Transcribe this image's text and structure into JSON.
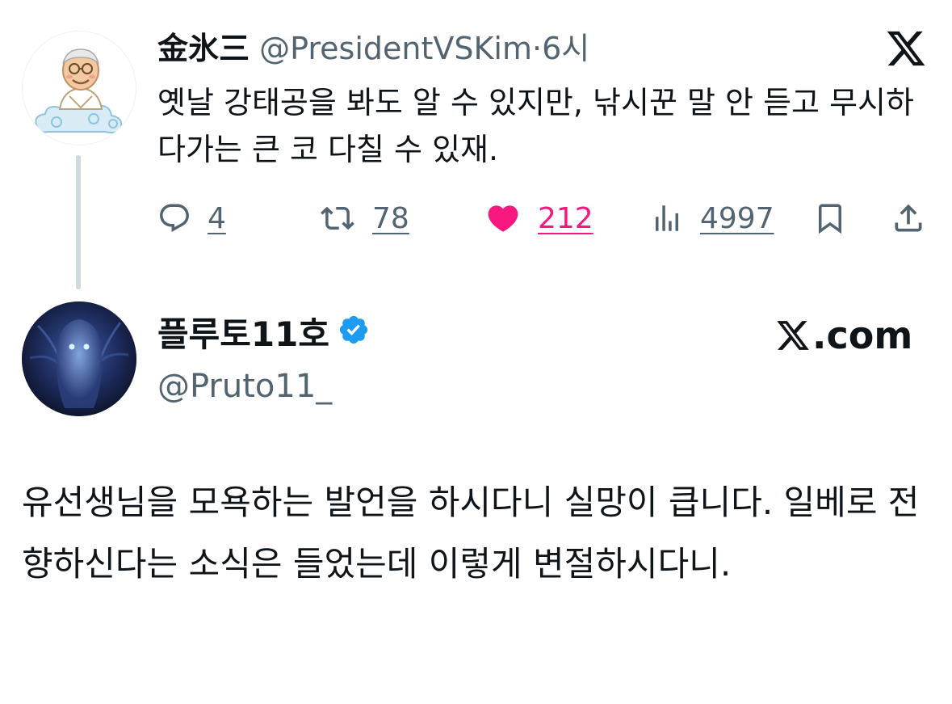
{
  "tweet": {
    "author_name": "金氷三",
    "handle": "@PresidentVSKim",
    "separator": "·",
    "time": "6시",
    "body": "옛날 강태공을 봐도 알 수 있지만, 낚시꾼 말 안 듣고 무시하다가는 큰 코 다칠 수 있재.",
    "platform_icon": "x-logo-icon",
    "actions": {
      "replies": "4",
      "retweets": "78",
      "likes": "212",
      "views": "4997"
    },
    "like_color": "#f91880"
  },
  "reply": {
    "author_name": "플루토11호",
    "handle": "@Pruto11_",
    "verified": true,
    "verified_color": "#1d9bf0",
    "source": ".com",
    "body": "유선생님을 모욕하는 발언을 하시다니 실망이 큽니다. 일베로 전향하신다는 소식은 들었는데 이렇게 변절하시다니."
  }
}
